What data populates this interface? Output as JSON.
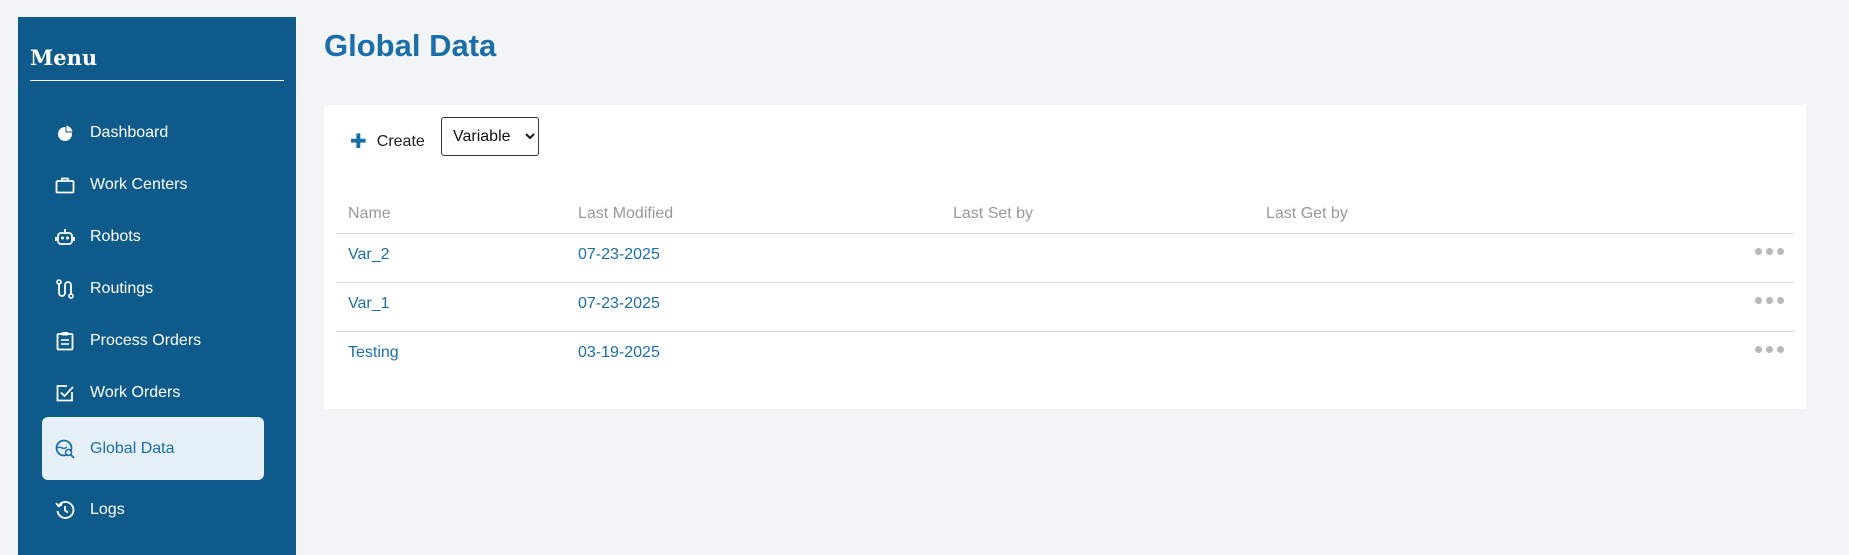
{
  "sidebar": {
    "title": "Menu",
    "items": [
      {
        "label": "Dashboard",
        "icon": "pie-chart-icon"
      },
      {
        "label": "Work Centers",
        "icon": "briefcase-icon"
      },
      {
        "label": "Robots",
        "icon": "robot-icon"
      },
      {
        "label": "Routings",
        "icon": "route-icon"
      },
      {
        "label": "Process Orders",
        "icon": "clipboard-icon"
      },
      {
        "label": "Work Orders",
        "icon": "checked-box-icon"
      },
      {
        "label": "Global Data",
        "icon": "globe-search-icon",
        "active": true
      },
      {
        "label": "Logs",
        "icon": "history-icon"
      }
    ]
  },
  "main": {
    "title": "Global Data",
    "toolbar": {
      "create_label": "Create",
      "type_select": {
        "selected": "Variable",
        "options": [
          "Variable"
        ]
      }
    },
    "table": {
      "columns": [
        "Name",
        "Last Modified",
        "Last Set by",
        "Last Get by"
      ],
      "rows": [
        {
          "name": "Var_2",
          "last_modified": "07-23-2025",
          "last_set_by": "",
          "last_get_by": ""
        },
        {
          "name": "Var_1",
          "last_modified": "07-23-2025",
          "last_set_by": "",
          "last_get_by": ""
        },
        {
          "name": "Testing",
          "last_modified": "03-19-2025",
          "last_set_by": "",
          "last_get_by": ""
        }
      ]
    }
  },
  "colors": {
    "sidebar_bg": "#0e5a8a",
    "accent": "#1a6fa8",
    "active_bg": "#e6f0f8",
    "page_bg": "#f3f4f6"
  }
}
